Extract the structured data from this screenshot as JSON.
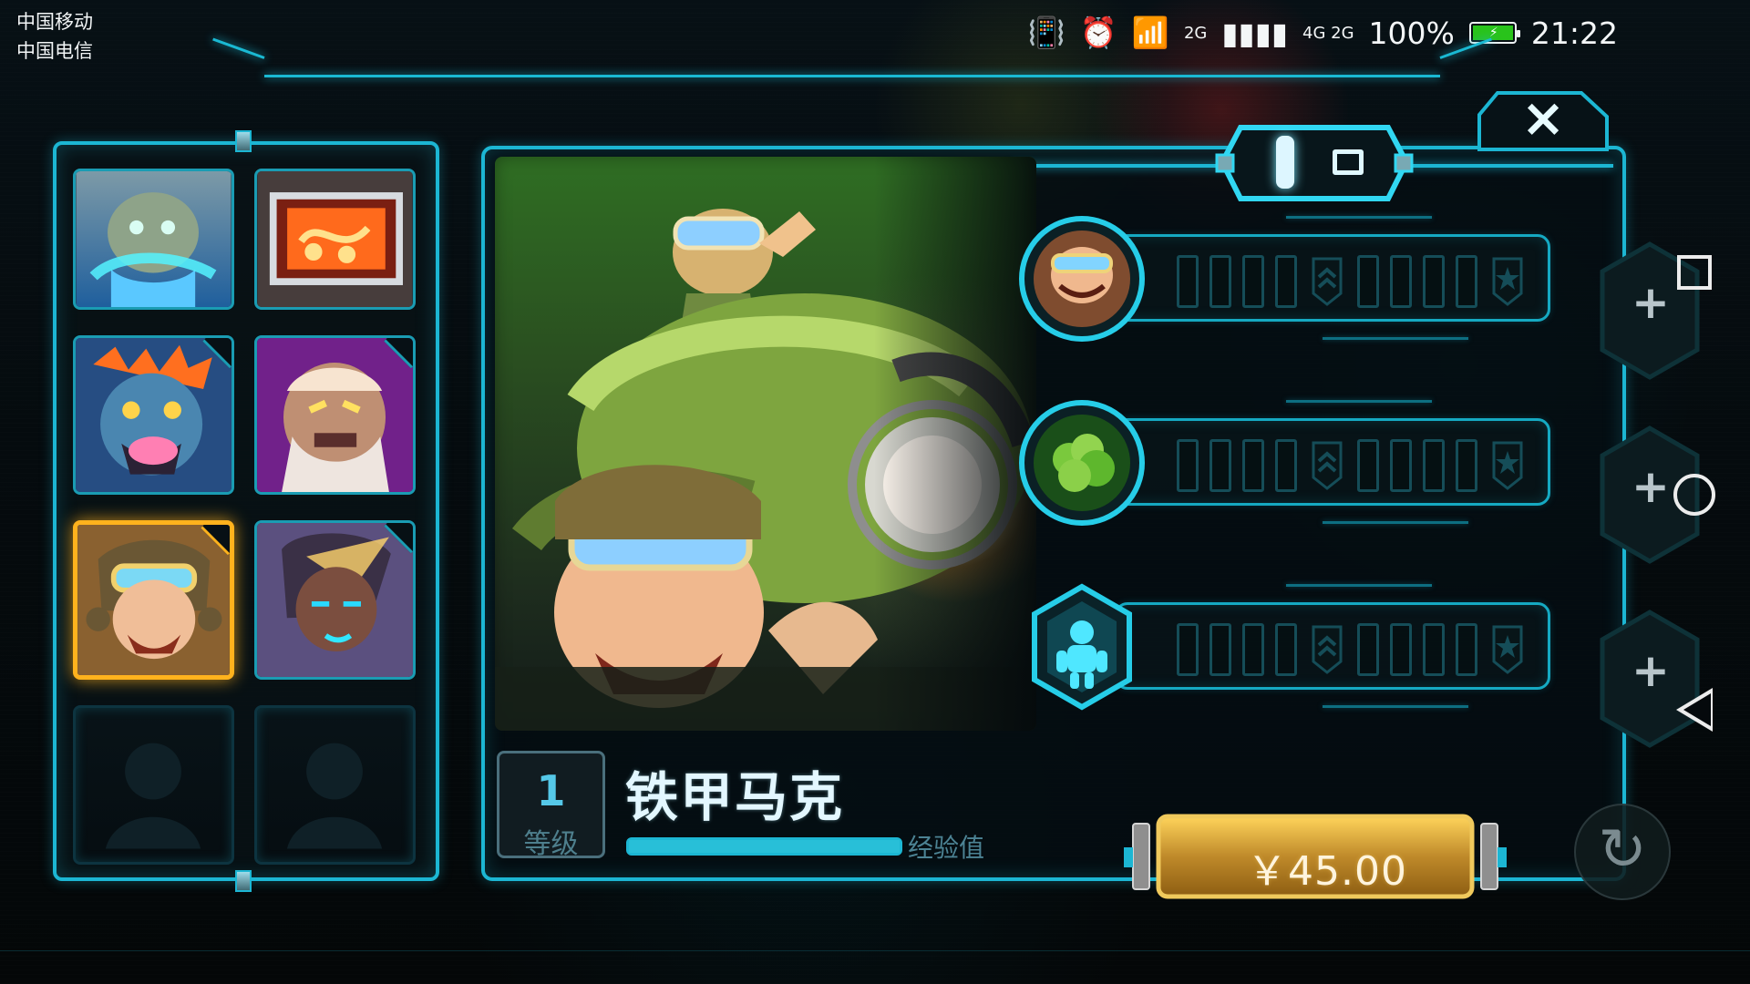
{
  "status_bar": {
    "carrier_1": "中国移动",
    "carrier_2": "中国电信",
    "network_1": "2G",
    "network_2": "4G 2G",
    "battery_percent": "100%",
    "time": "21:22",
    "icons": [
      "vibrate-icon",
      "alarm-icon",
      "wifi-icon",
      "signal-icon",
      "battery-icon"
    ]
  },
  "hero_selector": {
    "slots": [
      {
        "name": "slot-1",
        "state": "normal",
        "icon": "stone-beast-portrait"
      },
      {
        "name": "slot-2",
        "state": "normal",
        "icon": "red-screen-portrait"
      },
      {
        "name": "slot-3",
        "state": "normal",
        "icon": "blue-troll-portrait"
      },
      {
        "name": "slot-4",
        "state": "normal",
        "icon": "old-warrior-portrait"
      },
      {
        "name": "slot-5",
        "state": "selected",
        "icon": "goggle-soldier-portrait"
      },
      {
        "name": "slot-6",
        "state": "normal",
        "icon": "tribal-woman-portrait"
      },
      {
        "name": "slot-7",
        "state": "empty",
        "icon": "silhouette-slot"
      },
      {
        "name": "slot-8",
        "state": "empty",
        "icon": "silhouette-slot"
      }
    ]
  },
  "hero_detail": {
    "level": "1",
    "level_label": "等级",
    "name": "铁甲马克",
    "exp_label": "经验值",
    "exp_progress": 1.0
  },
  "skills": [
    {
      "icon": "pilot-icon",
      "tiers": [
        "pip",
        "pip",
        "pip",
        "pip",
        "chevron-badge",
        "pip",
        "pip",
        "pip",
        "pip",
        "star-badge"
      ]
    },
    {
      "icon": "green-bush-icon",
      "tiers": [
        "pip",
        "pip",
        "pip",
        "pip",
        "chevron-badge",
        "pip",
        "pip",
        "pip",
        "pip",
        "star-badge"
      ]
    },
    {
      "icon": "robot-icon",
      "tiers": [
        "pip",
        "pip",
        "pip",
        "pip",
        "chevron-badge",
        "pip",
        "pip",
        "pip",
        "pip",
        "star-badge"
      ]
    }
  ],
  "purchase": {
    "price": "￥45.00"
  },
  "controls": {
    "close_label": "×",
    "refresh_icon": "refresh-icon",
    "toggle_icon_left": "bar-icon",
    "toggle_icon_right": "square-icon"
  },
  "system_nav": {
    "square": "recent-apps-icon",
    "circle": "home-icon",
    "back": "back-icon"
  },
  "colors": {
    "accent_cyan": "#1cb6d3",
    "gold": "#ffb21d",
    "price_gold": "#c8911f",
    "dark_bg": "#050b0e"
  }
}
